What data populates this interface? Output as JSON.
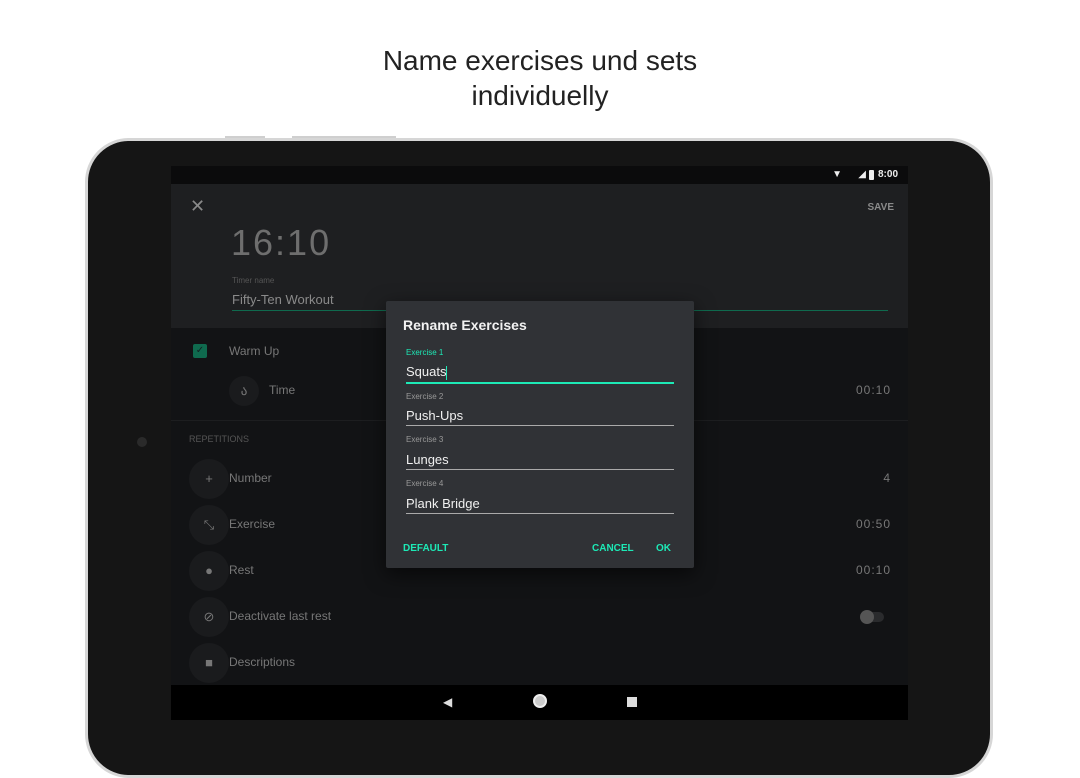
{
  "caption": {
    "line1": "Name exercises und sets",
    "line2": "individuelly"
  },
  "status_bar": {
    "time": "8:00",
    "icons": [
      "wifi-icon",
      "lte-signal-icon",
      "battery-icon"
    ]
  },
  "header": {
    "close_icon": "close-icon",
    "save_label": "SAVE",
    "total_time": "16:10",
    "timer_name_label": "Timer name",
    "timer_name_value": "Fifty-Ten Workout"
  },
  "warmup": {
    "label": "Warm Up",
    "checked": true,
    "time_label": "Time",
    "time_value": "00:10"
  },
  "repetitions": {
    "section_label": "REPETITIONS",
    "rows": [
      {
        "icon": "plus-icon",
        "label": "Number",
        "value": "4"
      },
      {
        "icon": "expand-icon",
        "label": "Exercise",
        "value": "00:50"
      },
      {
        "icon": "drop-icon",
        "label": "Rest",
        "value": "00:10"
      },
      {
        "icon": "no-rest-icon",
        "label": "Deactivate last rest",
        "value": ""
      },
      {
        "icon": "label-icon",
        "label": "Descriptions",
        "value": ""
      }
    ],
    "deactivate_last_rest": false
  },
  "dialog": {
    "title": "Rename Exercises",
    "fields": [
      {
        "label": "Exercise 1",
        "value": "Squats"
      },
      {
        "label": "Exercise 2",
        "value": "Push-Ups"
      },
      {
        "label": "Exercise 3",
        "value": "Lunges"
      },
      {
        "label": "Exercise 4",
        "value": "Plank Bridge"
      }
    ],
    "default_label": "DEFAULT",
    "cancel_label": "CANCEL",
    "ok_label": "OK"
  },
  "colors": {
    "accent": "#1de9b6",
    "dialog_bg": "#303236"
  }
}
